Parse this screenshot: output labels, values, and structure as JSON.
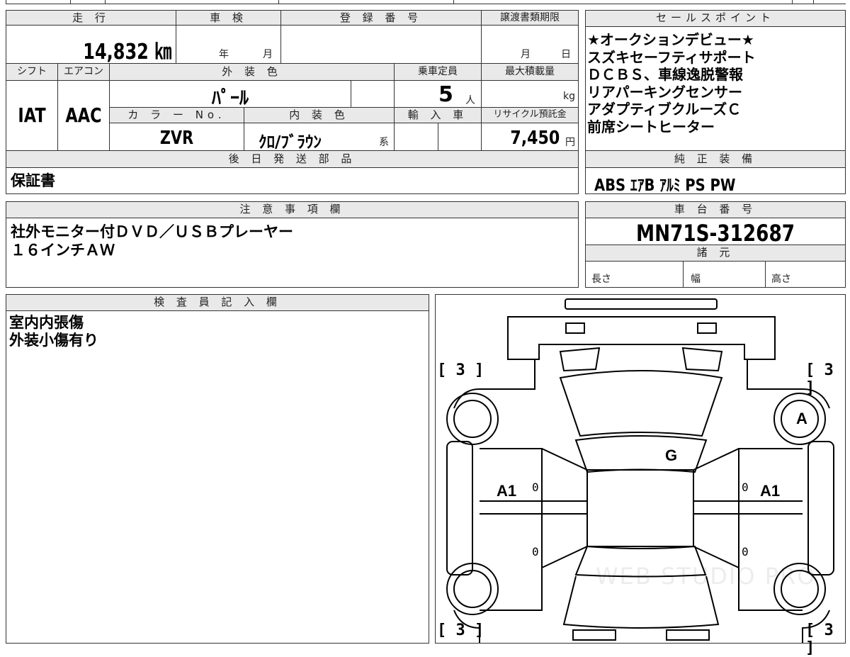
{
  "vehicle": {
    "mileage_header": "走 行",
    "mileage": "14,832 ㎞",
    "shaken_header": "車 検",
    "shaken_year_label": "年",
    "shaken_month_label": "月",
    "registration_header": "登 録 番 号",
    "registration_value": "",
    "transfer_deadline_header": "譲渡書類期限",
    "transfer_month_label": "月",
    "transfer_day_label": "日",
    "shift_header": "シフト",
    "shift": "IAT",
    "aircon_header": "エアコン",
    "aircon": "AAC",
    "exterior_color_header": "外 装 色",
    "exterior_color": "ﾊﾟｰﾙ",
    "color_no_header": "カ ラ ー No.",
    "color_no": "ZVR",
    "interior_color_header": "内 装 色",
    "interior_color": "ｸﾛ/ﾌﾞﾗｳﾝ",
    "interior_suffix": "系",
    "capacity_header": "乗車定員",
    "capacity": "5",
    "capacity_unit": "人",
    "max_load_header": "最大積載量",
    "max_load_unit": "kg",
    "import_header": "輸 入 車",
    "recycle_header": "リサイクル預託金",
    "recycle_fee": "7,450",
    "recycle_unit": "円"
  },
  "later_shipping": {
    "header": "後 日 発 送 部 品",
    "value": "保証書"
  },
  "sales_points": {
    "header": "セールスポイント",
    "lines": [
      "★オークションデビュー★",
      "スズキセーフティサポート",
      "ＤＣＢＳ、車線逸脱警報",
      "リアパーキングセンサー",
      "アダプティブクルーズＣ",
      "前席シートヒーター"
    ]
  },
  "equipment": {
    "header": "純 正 装 備",
    "value": "ABS ｴｱB ｱﾙﾐ PS PW"
  },
  "notes": {
    "header": "注 意 事 項 欄",
    "lines": [
      "社外モニター付ＤＶＤ／ＵＳＢプレーヤー",
      "１６インチＡＷ"
    ]
  },
  "chassis": {
    "header": "車 台 番 号",
    "value": "MN71S-312687"
  },
  "specs": {
    "header": "諸 元",
    "length_label": "長さ",
    "width_label": "幅",
    "height_label": "高さ"
  },
  "inspector": {
    "header": "検 査 員 記 入 欄",
    "lines": [
      "室内内張傷",
      "外装小傷有り"
    ]
  },
  "diagram": {
    "tire_tl": "3",
    "tire_tr": "3",
    "tire_bl": "3",
    "tire_br": "3",
    "mark_roof": "G",
    "mark_right_front_tire": "A",
    "mark_left_door": "A1",
    "mark_right_door": "A1",
    "zero": "0",
    "watermark": "WEB STUDIO PRO"
  }
}
